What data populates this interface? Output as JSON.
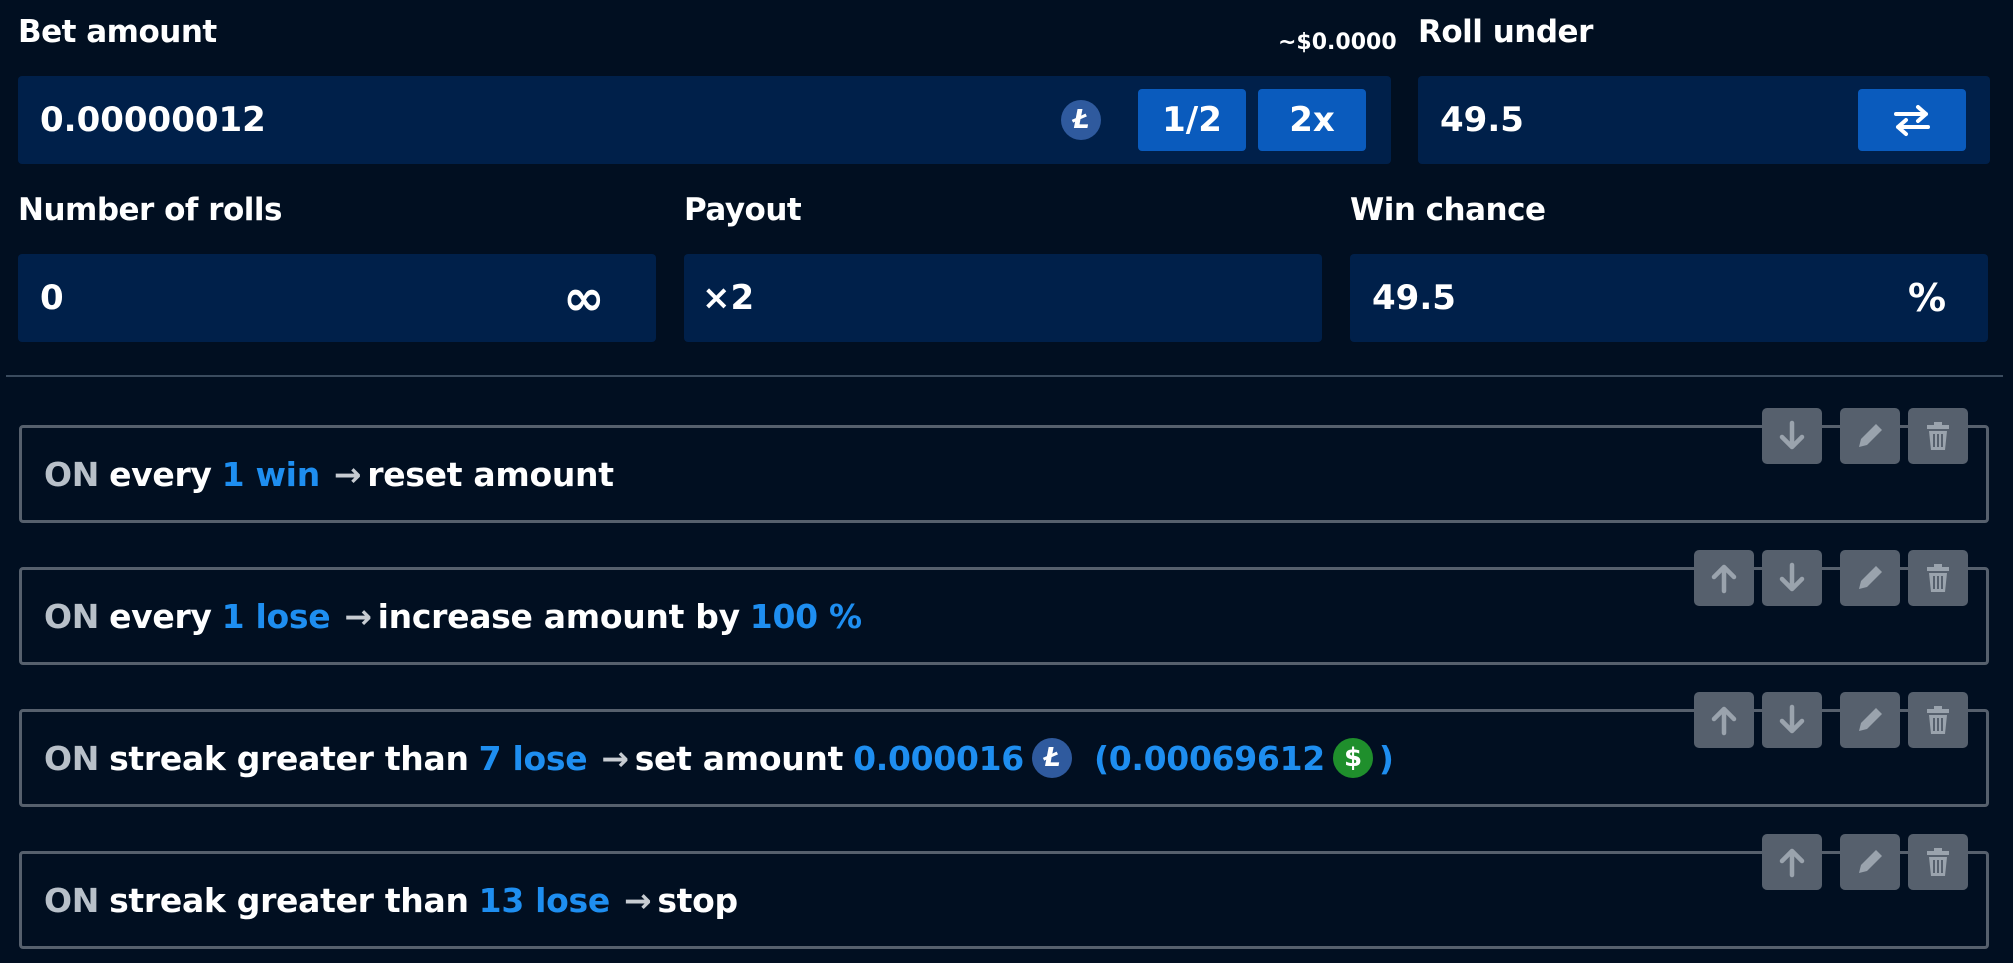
{
  "bet": {
    "label": "Bet amount",
    "usd_estimate": "~$0.0000",
    "value": "0.00000012",
    "coin_icon": "litecoin-icon",
    "half_label": "1/2",
    "double_label": "2x"
  },
  "roll_under": {
    "label": "Roll under",
    "value": "49.5",
    "swap_icon": "swap-arrows-icon"
  },
  "rolls": {
    "label": "Number of rolls",
    "value": "0",
    "infinity_symbol": "∞"
  },
  "payout": {
    "label": "Payout",
    "value": "×2"
  },
  "win_chance": {
    "label": "Win chance",
    "value": "49.5",
    "unit": "%"
  },
  "rules": [
    {
      "on": "ON",
      "parts": [
        "every",
        "1 win",
        "→",
        "reset amount"
      ],
      "actions": [
        "down",
        "edit",
        "delete"
      ]
    },
    {
      "on": "ON",
      "parts": [
        "every",
        "1 lose",
        "→",
        "increase amount by",
        "100 %"
      ],
      "actions": [
        "up",
        "down",
        "edit",
        "delete"
      ]
    },
    {
      "on": "ON",
      "parts": [
        "streak greater than",
        "7 lose",
        "→",
        "set amount",
        "0.000016",
        "(0.00069612",
        ")"
      ],
      "actions": [
        "up",
        "down",
        "edit",
        "delete"
      ]
    },
    {
      "on": "ON",
      "parts": [
        "streak greater than",
        "13 lose",
        "→",
        "stop"
      ],
      "actions": [
        "up",
        "edit",
        "delete"
      ]
    }
  ],
  "colors": {
    "background": "#010f21",
    "field": "#00204a",
    "button": "#0a5bbd",
    "highlight": "#1e8ef0",
    "rule_border": "#56606d"
  }
}
